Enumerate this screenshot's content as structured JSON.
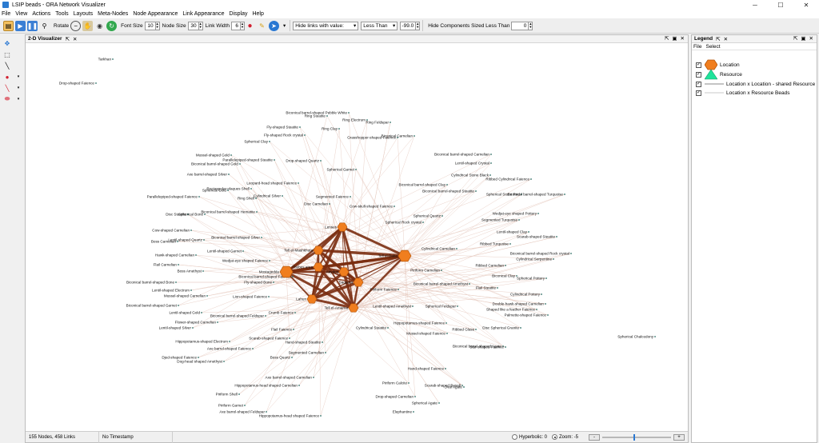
{
  "window": {
    "title": "LSIP beads - ORA Network Visualizer",
    "minimize": "─",
    "maximize": "☐",
    "close": "✕"
  },
  "menu": [
    "File",
    "View",
    "Actions",
    "Tools",
    "Layouts",
    "Meta-Nodes",
    "Node Appearance",
    "Link Appearance",
    "Display",
    "Help"
  ],
  "toolbar": {
    "rotate_label": "Rotate",
    "font_size_label": "Font Size",
    "font_size": "10",
    "node_size_label": "Node Size",
    "node_size": "30",
    "link_width_label": "Link Width",
    "link_width": "6",
    "hide_links_option": "Hide links with value:",
    "comparison_option": "Less Than",
    "threshold": "-99.0",
    "hide_components_label": "Hide Components Sized Less Than",
    "component_size": "0"
  },
  "visualizer": {
    "tab_label": "2-D Visualizer",
    "pin": "⇱",
    "close": "✕",
    "status": {
      "counts": "155 Nodes, 458 Links",
      "timestamp": "No Timestamp",
      "hyperbolic_label": "Hyperbolic: 0",
      "zoom_label": "Zoom: -5",
      "zoom_minus": "-",
      "zoom_plus": "+",
      "zoom_fraction": 0.45
    }
  },
  "legend": {
    "title": "Legend",
    "menu": [
      "File",
      "Select"
    ],
    "items": [
      {
        "label": "Location",
        "kind": "hexagon",
        "color": "#f07e1e"
      },
      {
        "label": "Resource",
        "kind": "triangle",
        "color": "#1fe39b"
      },
      {
        "label": "Location x Location - shared Resource",
        "kind": "link",
        "color": "#8a8a8a"
      },
      {
        "label": "Location x Resource Beads",
        "kind": "link",
        "color": "#b9b9b9"
      }
    ]
  },
  "colors": {
    "location": "#f07e1e",
    "location_stroke": "#b5560b",
    "link_strong": "#7a2c10",
    "link_faint": "#e4c7bb",
    "resource_dot": "#2b6f66",
    "accent": "#2a78d2"
  },
  "graph": {
    "hubs": [
      {
        "id": "h1",
        "label": "Lenses"
      },
      {
        "id": "h2",
        "label": "Tell el-Mashkhuta"
      },
      {
        "id": "h3",
        "label": "Tell el-Daba"
      },
      {
        "id": "h4",
        "label": "Mostagedda"
      },
      {
        "id": "h5",
        "label": "Thebes area"
      },
      {
        "id": "h6",
        "label": "Tell el-Amarna"
      },
      {
        "id": "h7",
        "label": "Abydos"
      },
      {
        "id": "h8",
        "label": "Lahun"
      },
      {
        "id": "h9",
        "label": "Saqqara"
      }
    ],
    "resources": [
      "Tarkhan",
      "Drop-shaped Faience",
      "Biconical barrel-shaped Pebble White",
      "Ring Steatite",
      "Ring Electrum",
      "Ring Feldspar",
      "Fly-shaped Steatite",
      "Ring Clay",
      "Fly-shaped Rock crystal",
      "Grasshopper-shaped Faience",
      "Biconical Carnelian",
      "Spherical Clay",
      "Mussel-shaped Gold",
      "Parallelepiped-shaped Steatite",
      "Drop-shaped Quartz",
      "Spherical Garnet",
      "Biconical barrel-shaped Gold",
      "Axe barrel-shaped Silver",
      "Biconical barrel-shaped Carnelian",
      "Lentil-shaped Crystal",
      "Cylindrical Stone Black",
      "Ribbed Cylindrical Faience",
      "Leopard-head shaped Faience",
      "Rectangular plaques Shell",
      "Biconical barrel-shaped Clay",
      "Spherical Gold",
      "Cylindrical Silver",
      "Segmented Faience",
      "Biconical barrel-shaped Steatite",
      "Parallelepiped-shaped Faience",
      "Ring Shell",
      "Disc Carnelian",
      "Spherical Stone Red",
      "Biconical barrel-shaped Turquoise",
      "Disc Steatite",
      "Spherical Bone",
      "Biconical barrel-shaped Hematite",
      "Cow-skull-shaped Faience",
      "Spherical Quartz",
      "Wedjat-eye shaped Pottery",
      "Spherical Rock crystal",
      "Segmented Turquoise",
      "Cow-shaped Carnelian",
      "Lentil-shaped Clay",
      "Scarab-shaped Steatite",
      "Boss Carnelian",
      "Lentil-shaped Quartz",
      "Biconical barrel-shaped Silver",
      "Ribbed Turquoise",
      "Hawk-shaped Carnelian",
      "Lentil-shaped Garnet",
      "Cylindrical Carnelian",
      "Biconical barrel-shaped Rock crystal",
      "Flail Carnelian",
      "Wedjat-eye shaped Faience",
      "Cylindrical Serpentine",
      "Boss Amethyst",
      "Biconical barrel-shaped Faience",
      "Piriform Carnelian",
      "Ribbed Carnelian",
      "Biconical Clay",
      "Spherical Pottery",
      "Biconical barrel-shaped Bone",
      "Fly-shaped Bone",
      "Biconical barrel-shaped Amethyst",
      "Flail Steatite",
      "Lentil-shaped Electrum",
      "Piriform Faience",
      "Cylindrical Pottery",
      "Mussel-shaped Carnelian",
      "Lion-shaped Faience",
      "Double-hawk-shaped Carnelian",
      "Biconical barrel-shaped Garnet",
      "Lentil-shaped Amethyst",
      "Spherical Feldspar",
      "Shaped like a feather Faience",
      "Lentil-shaped Gold",
      "Crumb Faience",
      "Palmette-shaped Faience",
      "Flower-shaped Carnelian",
      "Biconical barrel-shaped Feldspar",
      "Hippopotamus-shaped Faience",
      "Ribbed Glass",
      "Disc Spherical Granite",
      "Lentil-shaped Silver",
      "Cylindrical Steatite",
      "Mussel-shaped Faience",
      "Hippopotamus-shaped Electrum",
      "Flail Faience",
      "Hand-shaped Steatite",
      "Biconical barrel-shaped Agate",
      "Star-shaped Faience",
      "Axe barrel-shaped Faience",
      "Scarab-shaped Faience",
      "Segmented Carnelian",
      "Djed-shaped Faience",
      "Boss Quartz",
      "Dog-head shaped Amethyst",
      "Hand-shaped Faience",
      "Axe barrel-shaped Carnelian",
      "Scarab-shaped Basalt",
      "Hippopotamus-head shaped Carnelian",
      "Piriform Calcite",
      "Oval Agate",
      "Piriform Shell",
      "Drop-shaped Carnelian",
      "Piriform Garnet",
      "Spherical Agate",
      "Axe barrel-shaped Feldspar",
      "Hippopotamus-head shaped Faience",
      "Elephantine",
      "Spherical Chalcedony"
    ]
  }
}
